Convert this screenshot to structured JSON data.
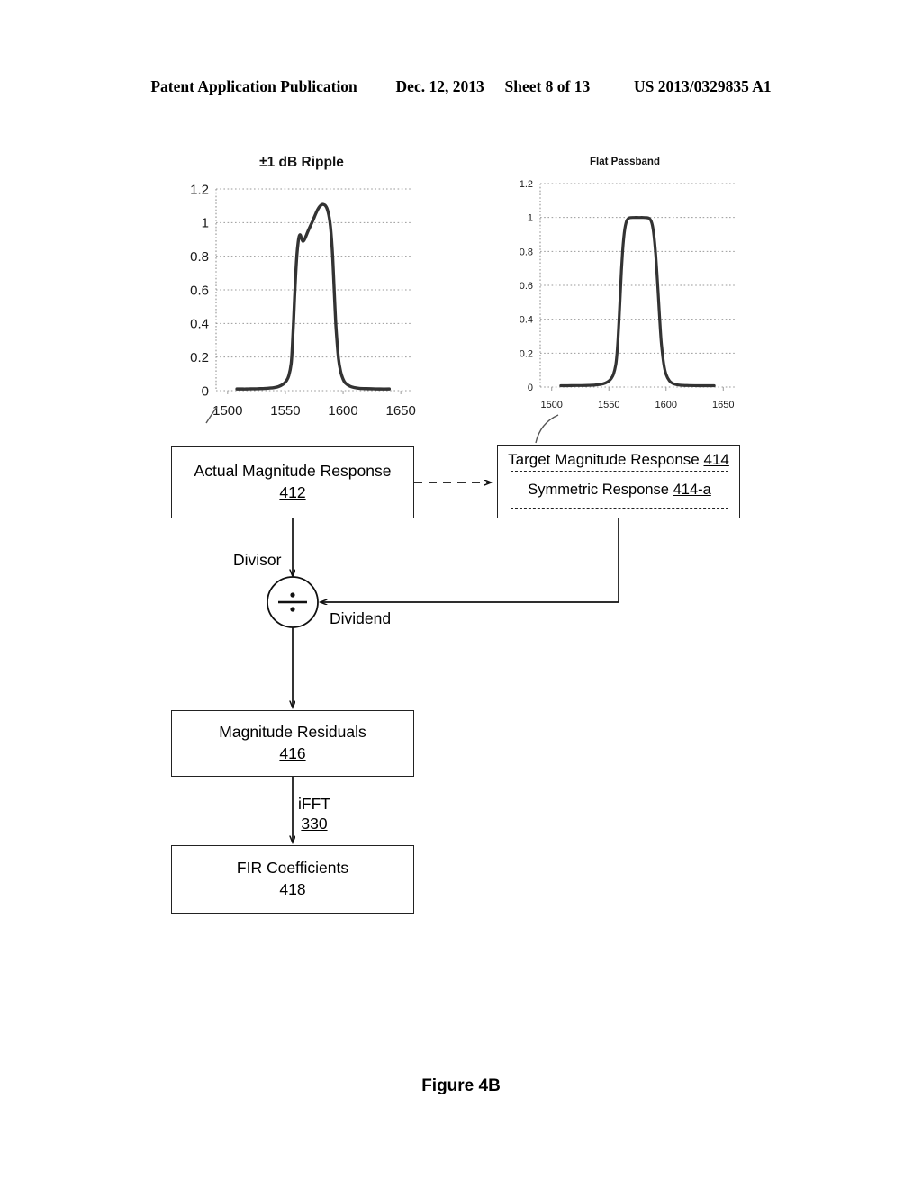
{
  "header": {
    "publication": "Patent Application Publication",
    "date": "Dec. 12, 2013",
    "sheet": "Sheet 8 of 13",
    "number": "US 2013/0329835 A1"
  },
  "figure": {
    "caption": "Figure 4B"
  },
  "boxes": {
    "actual": {
      "title": "Actual Magnitude Response",
      "ref": "412"
    },
    "target": {
      "title": "Target Magnitude Response",
      "ref": "414"
    },
    "symmetric": {
      "title": "Symmetric Response",
      "ref": "414-a"
    },
    "residuals": {
      "title": "Magnitude Residuals",
      "ref": "416"
    },
    "fir": {
      "title": "FIR Coefficients",
      "ref": "418"
    }
  },
  "edges": {
    "divisor": "Divisor",
    "dividend": "Dividend",
    "ifft": "iFFT",
    "ifft_ref": "330",
    "operator": "÷"
  },
  "chart_data": [
    {
      "id": "ripple",
      "type": "line",
      "title": "±1 dB Ripple",
      "xlabel": "",
      "ylabel": "",
      "xlim": [
        1490,
        1660
      ],
      "ylim": [
        0,
        1.2
      ],
      "xticks": [
        1500,
        1550,
        1600,
        1650
      ],
      "yticks": [
        0,
        0.2,
        0.4,
        0.6,
        0.8,
        1,
        1.2
      ],
      "ytick_labels": [
        "0",
        "0.2",
        "0.4",
        "0.6",
        "0.8",
        "1",
        "1.2"
      ],
      "xtick_labels": [
        "1500",
        "1550",
        "1600",
        "1650"
      ],
      "grid": true,
      "legend": "none",
      "x": [
        1508,
        1512,
        1516,
        1520,
        1524,
        1528,
        1532,
        1536,
        1540,
        1544,
        1548,
        1551,
        1553,
        1555,
        1556,
        1557,
        1558,
        1559,
        1560,
        1561,
        1562,
        1563,
        1564,
        1565,
        1566,
        1567,
        1568,
        1570,
        1572,
        1574,
        1576,
        1578,
        1580,
        1582,
        1584,
        1585,
        1586,
        1587,
        1588,
        1589,
        1590,
        1591,
        1592,
        1593,
        1594,
        1596,
        1598,
        1600,
        1602,
        1606,
        1610,
        1614,
        1620,
        1626,
        1632,
        1640
      ],
      "y": [
        0.01,
        0.01,
        0.01,
        0.011,
        0.011,
        0.012,
        0.013,
        0.015,
        0.018,
        0.024,
        0.038,
        0.06,
        0.09,
        0.16,
        0.26,
        0.4,
        0.56,
        0.7,
        0.81,
        0.88,
        0.92,
        0.926,
        0.905,
        0.89,
        0.893,
        0.905,
        0.922,
        0.955,
        0.985,
        1.015,
        1.048,
        1.078,
        1.098,
        1.108,
        1.105,
        1.098,
        1.085,
        1.062,
        1.03,
        0.98,
        0.9,
        0.79,
        0.64,
        0.49,
        0.36,
        0.19,
        0.11,
        0.068,
        0.045,
        0.026,
        0.018,
        0.014,
        0.012,
        0.011,
        0.01,
        0.01
      ]
    },
    {
      "id": "flat",
      "type": "line",
      "title": "Flat Passband",
      "xlabel": "",
      "ylabel": "",
      "xlim": [
        1490,
        1660
      ],
      "ylim": [
        0,
        1.2
      ],
      "xticks": [
        1500,
        1550,
        1600,
        1650
      ],
      "yticks": [
        0,
        0.2,
        0.4,
        0.6,
        0.8,
        1,
        1.2
      ],
      "ytick_labels": [
        "0",
        "0.2",
        "0.4",
        "0.6",
        "0.8",
        "1",
        "1.2"
      ],
      "xtick_labels": [
        "1500",
        "1550",
        "1600",
        "1650"
      ],
      "grid": true,
      "legend": "none",
      "x": [
        1508,
        1514,
        1520,
        1526,
        1532,
        1538,
        1543,
        1547,
        1550,
        1552,
        1554,
        1556,
        1557,
        1558,
        1559,
        1560,
        1561,
        1562,
        1563,
        1564,
        1565,
        1566,
        1568,
        1572,
        1576,
        1580,
        1583,
        1585,
        1586,
        1587,
        1588,
        1589,
        1590,
        1591,
        1592,
        1593,
        1594,
        1595,
        1596,
        1598,
        1600,
        1603,
        1606,
        1610,
        1615,
        1620,
        1628,
        1636,
        1642
      ],
      "y": [
        0.008,
        0.008,
        0.009,
        0.009,
        0.01,
        0.012,
        0.016,
        0.024,
        0.036,
        0.05,
        0.075,
        0.13,
        0.19,
        0.285,
        0.41,
        0.55,
        0.69,
        0.8,
        0.88,
        0.935,
        0.968,
        0.986,
        0.998,
        1.0,
        1.0,
        1.0,
        0.999,
        0.996,
        0.99,
        0.978,
        0.955,
        0.915,
        0.855,
        0.775,
        0.675,
        0.565,
        0.45,
        0.34,
        0.25,
        0.135,
        0.075,
        0.036,
        0.021,
        0.013,
        0.01,
        0.009,
        0.008,
        0.008,
        0.008
      ]
    }
  ]
}
